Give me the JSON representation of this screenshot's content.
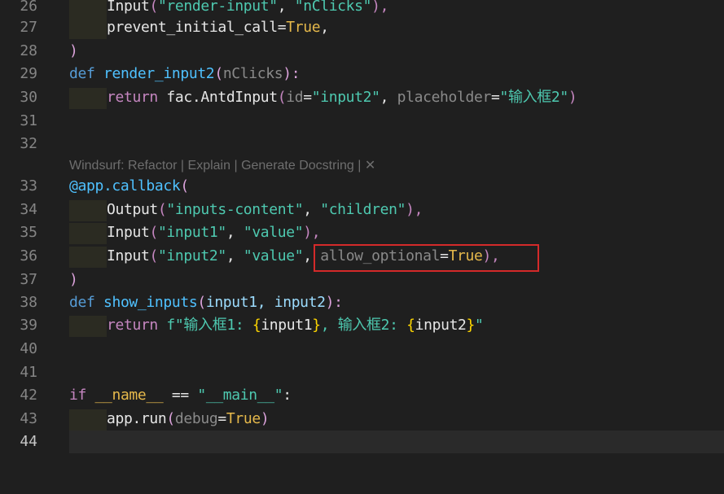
{
  "editor": {
    "codelens": {
      "prefix": "Windsurf: ",
      "refactor": "Refactor",
      "sep1": " | ",
      "explain": "Explain",
      "sep2": " | ",
      "docstring": "Generate Docstring",
      "sep3": " | ",
      "close": "✕"
    },
    "lines": [
      {
        "num": "26",
        "t": [
          "Input",
          "(",
          "\"render-input\"",
          ", ",
          "\"nClicks\"",
          "),"
        ]
      },
      {
        "num": "27",
        "t": [
          "prevent_initial_call",
          "=",
          "True",
          ","
        ]
      },
      {
        "num": "28",
        "t": [
          ")"
        ]
      },
      {
        "num": "29",
        "t": [
          "def",
          " ",
          "render_input2",
          "(",
          "nClicks",
          "):"
        ]
      },
      {
        "num": "30",
        "t": [
          "return",
          " fac.AntdInput",
          "(",
          "id",
          "=",
          "\"input2\"",
          ", ",
          "placeholder",
          "=",
          "\"输入框2\"",
          ")"
        ]
      },
      {
        "num": "31",
        "t": []
      },
      {
        "num": "32",
        "t": []
      },
      {
        "num": "33",
        "t": [
          "@app.callback",
          "("
        ]
      },
      {
        "num": "34",
        "t": [
          "Output",
          "(",
          "\"inputs-content\"",
          ", ",
          "\"children\"",
          "),"
        ]
      },
      {
        "num": "35",
        "t": [
          "Input",
          "(",
          "\"input1\"",
          ", ",
          "\"value\"",
          "),"
        ]
      },
      {
        "num": "36",
        "t": [
          "Input",
          "(",
          "\"input2\"",
          ", ",
          "\"value\"",
          ", ",
          "allow_optional",
          "=",
          "True",
          "),"
        ]
      },
      {
        "num": "37",
        "t": [
          ")"
        ]
      },
      {
        "num": "38",
        "t": [
          "def",
          " ",
          "show_inputs",
          "(",
          "input1, input2",
          "):"
        ]
      },
      {
        "num": "39",
        "t": [
          "return",
          " ",
          "f\"输入框1: ",
          "{",
          "input1",
          "}",
          ", 输入框2: ",
          "{",
          "input2",
          "}",
          "\""
        ]
      },
      {
        "num": "40",
        "t": []
      },
      {
        "num": "41",
        "t": []
      },
      {
        "num": "42",
        "t": [
          "if",
          " ",
          "__name__",
          " == ",
          "\"__main__\"",
          ":"
        ]
      },
      {
        "num": "43",
        "t": [
          "app.run",
          "(",
          "debug",
          "=",
          "True",
          ")"
        ]
      },
      {
        "num": "44",
        "t": []
      }
    ]
  },
  "colors": {
    "background": "#1f1f1f",
    "highlight_box": "#d42a2a"
  }
}
